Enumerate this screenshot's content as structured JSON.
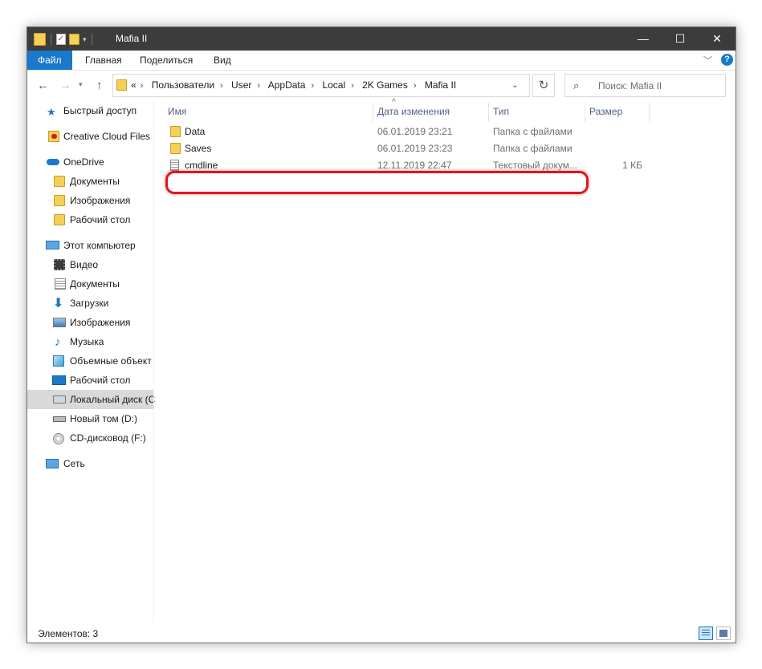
{
  "window": {
    "title": "Mafia II",
    "controls": {
      "minimize": "—",
      "maximize": "☐",
      "close": "✕"
    }
  },
  "ribbon": {
    "tabs": [
      "Файл",
      "Главная",
      "Поделиться",
      "Вид"
    ],
    "help": "?"
  },
  "address": {
    "overflow": "«",
    "path": [
      "Пользователи",
      "User",
      "AppData",
      "Local",
      "2K Games",
      "Mafia II"
    ],
    "separator": "›"
  },
  "search": {
    "placeholder": "Поиск: Mafia II"
  },
  "sidebar": {
    "items": [
      {
        "label": "Быстрый доступ",
        "icon": "star-icon"
      },
      {
        "label": "Creative Cloud Files",
        "icon": "creative-cloud-icon"
      },
      {
        "label": "OneDrive",
        "icon": "cloud-icon"
      },
      {
        "label": "Документы",
        "icon": "folder-icon"
      },
      {
        "label": "Изображения",
        "icon": "folder-icon"
      },
      {
        "label": "Рабочий стол",
        "icon": "folder-icon"
      },
      {
        "label": "Этот компьютер",
        "icon": "computer-icon"
      },
      {
        "label": "Видео",
        "icon": "video-icon"
      },
      {
        "label": "Документы",
        "icon": "documents-icon"
      },
      {
        "label": "Загрузки",
        "icon": "download-icon"
      },
      {
        "label": "Изображения",
        "icon": "pictures-icon"
      },
      {
        "label": "Музыка",
        "icon": "music-icon"
      },
      {
        "label": "Объемные объект",
        "icon": "3d-objects-icon"
      },
      {
        "label": "Рабочий стол",
        "icon": "desktop-icon"
      },
      {
        "label": "Локальный диск (C",
        "icon": "local-disk-icon"
      },
      {
        "label": "Новый том (D:)",
        "icon": "drive-icon"
      },
      {
        "label": "CD-дисковод (F:)",
        "icon": "cd-drive-icon"
      },
      {
        "label": "Сеть",
        "icon": "network-icon"
      }
    ]
  },
  "columns": {
    "name": "Имя",
    "date": "Дата изменения",
    "type": "Тип",
    "size": "Размер"
  },
  "files": [
    {
      "name": "Data",
      "date": "06.01.2019 23:21",
      "type": "Папка с файлами",
      "size": "",
      "icon": "folder-icon"
    },
    {
      "name": "Saves",
      "date": "06.01.2019 23:23",
      "type": "Папка с файлами",
      "size": "",
      "icon": "folder-icon"
    },
    {
      "name": "cmdline",
      "date": "12.11.2019 22:47",
      "type": "Текстовый докум...",
      "size": "1 КБ",
      "icon": "text-file-icon"
    }
  ],
  "status": {
    "count": "Элементов: 3"
  },
  "colors": {
    "accent": "#1979ca",
    "titlebar": "#3c3c3c",
    "highlight": "#e0161b",
    "folder": "#f6cf58"
  }
}
